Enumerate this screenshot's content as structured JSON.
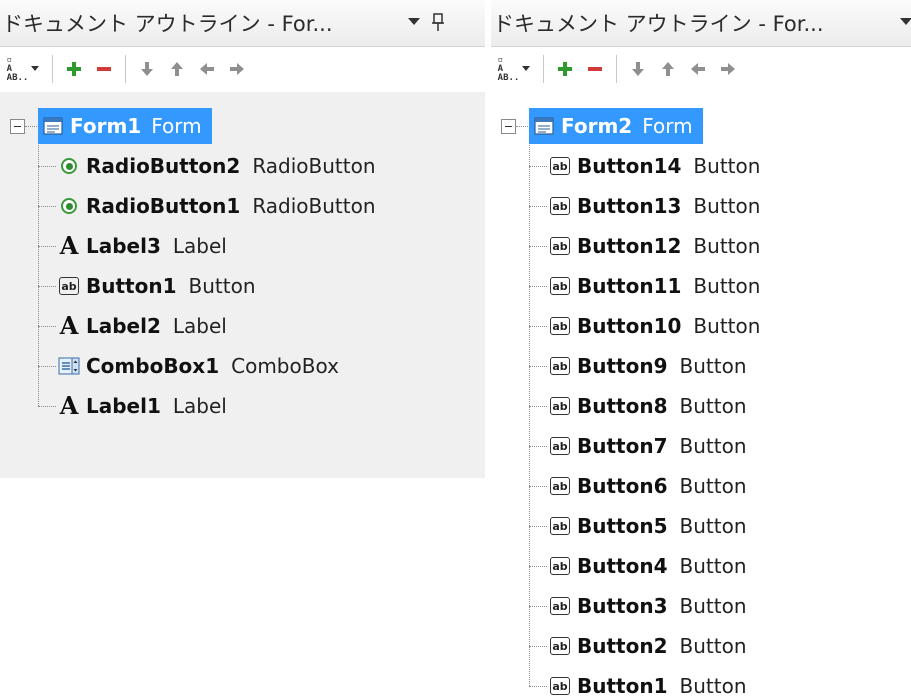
{
  "panels": [
    {
      "title": "ドキュメント アウトライン - For...",
      "toolbar": {
        "sort_icon": "sort-by-text-icon",
        "add_icon": "plus-icon",
        "remove_icon": "minus-icon",
        "move_down_icon": "arrow-down-icon",
        "move_up_icon": "arrow-up-icon",
        "move_left_icon": "arrow-left-icon",
        "move_right_icon": "arrow-right-icon"
      },
      "root": {
        "name": "Form1",
        "type": "Form",
        "icon": "form-icon"
      },
      "children": [
        {
          "name": "RadioButton2",
          "type": "RadioButton",
          "icon": "radio-button-icon"
        },
        {
          "name": "RadioButton1",
          "type": "RadioButton",
          "icon": "radio-button-icon"
        },
        {
          "name": "Label3",
          "type": "Label",
          "icon": "label-icon"
        },
        {
          "name": "Button1",
          "type": "Button",
          "icon": "button-icon"
        },
        {
          "name": "Label2",
          "type": "Label",
          "icon": "label-icon"
        },
        {
          "name": "ComboBox1",
          "type": "ComboBox",
          "icon": "combobox-icon"
        },
        {
          "name": "Label1",
          "type": "Label",
          "icon": "label-icon"
        }
      ]
    },
    {
      "title": "ドキュメント アウトライン - For...",
      "toolbar": {
        "sort_icon": "sort-by-text-icon",
        "add_icon": "plus-icon",
        "remove_icon": "minus-icon",
        "move_down_icon": "arrow-down-icon",
        "move_up_icon": "arrow-up-icon",
        "move_left_icon": "arrow-left-icon",
        "move_right_icon": "arrow-right-icon"
      },
      "root": {
        "name": "Form2",
        "type": "Form",
        "icon": "form-icon"
      },
      "children": [
        {
          "name": "Button14",
          "type": "Button",
          "icon": "button-icon"
        },
        {
          "name": "Button13",
          "type": "Button",
          "icon": "button-icon"
        },
        {
          "name": "Button12",
          "type": "Button",
          "icon": "button-icon"
        },
        {
          "name": "Button11",
          "type": "Button",
          "icon": "button-icon"
        },
        {
          "name": "Button10",
          "type": "Button",
          "icon": "button-icon"
        },
        {
          "name": "Button9",
          "type": "Button",
          "icon": "button-icon"
        },
        {
          "name": "Button8",
          "type": "Button",
          "icon": "button-icon"
        },
        {
          "name": "Button7",
          "type": "Button",
          "icon": "button-icon"
        },
        {
          "name": "Button6",
          "type": "Button",
          "icon": "button-icon"
        },
        {
          "name": "Button5",
          "type": "Button",
          "icon": "button-icon"
        },
        {
          "name": "Button4",
          "type": "Button",
          "icon": "button-icon"
        },
        {
          "name": "Button3",
          "type": "Button",
          "icon": "button-icon"
        },
        {
          "name": "Button2",
          "type": "Button",
          "icon": "button-icon"
        },
        {
          "name": "Button1",
          "type": "Button",
          "icon": "button-icon"
        }
      ]
    }
  ],
  "colors": {
    "selection": "#3399ff",
    "add_green": "#2e9a2e",
    "remove_red": "#d23a3a",
    "arrow_gray": "#8f8f8f"
  }
}
